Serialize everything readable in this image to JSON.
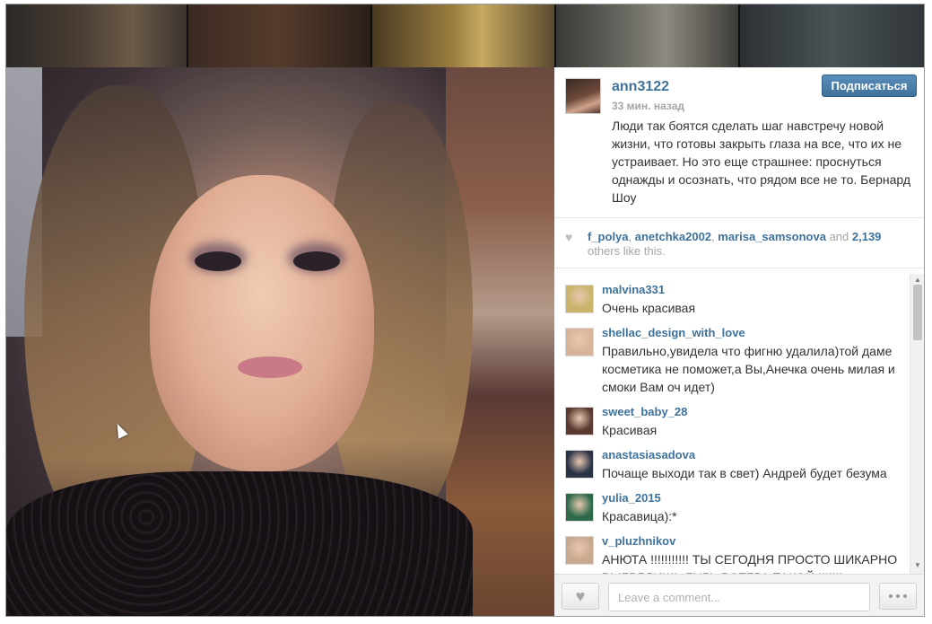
{
  "post": {
    "username": "ann3122",
    "time": "33 мин. назад",
    "follow_label": "Подписаться",
    "caption": "Люди так боятся сделать шаг навстречу новой жизни, что готовы закрыть глаза на все, что их не устраивает. Но это еще страшнее: проснуться однажды и осознать, что рядом все не то. Бернард Шоу"
  },
  "likes": {
    "likers": [
      "f_polya",
      "anetchka2002",
      "marisa_samsonova"
    ],
    "sep1": ", ",
    "sep2": ", ",
    "and_text": " and ",
    "count": "2,139",
    "suffix": " others like this."
  },
  "comments": [
    {
      "user": "malvina331",
      "text": "Очень красивая",
      "avatar_color": "#c9b46a"
    },
    {
      "user": "shellac_design_with_love",
      "text": "Правильно,увидела что фигню удалила)той даме косметика не поможет,а Вы,Анечка очень милая и смоки Вам оч идет)",
      "avatar_color": "#d8b49a"
    },
    {
      "user": "sweet_baby_28",
      "text": "Красивая ",
      "avatar_color": "#5a3a30"
    },
    {
      "user": "anastasiasadova",
      "text": "Почаще выходи так в свет) Андрей будет безума",
      "avatar_color": "#2a3346"
    },
    {
      "user": "yulia_2015",
      "text": "Красавица):*",
      "avatar_color": "#2e6a4a"
    },
    {
      "user": "v_pluzhnikov",
      "text": "АНЮТА !!!!!!!!!!! ТЫ СЕГОДНЯ ПРОСТО ШИКАРНО ВЫГЛЯДИШЬ БУДЬ ВСЕГДА ТАКОЙ !!!!!!!",
      "avatar_color": "#c9a890"
    }
  ],
  "comment_box": {
    "placeholder": "Leave a comment...",
    "like_icon": "heart-icon",
    "more_icon": "more-dots-icon"
  },
  "colors": {
    "link": "#3f729b",
    "follow_button": "#3f729b",
    "muted": "#a5a5a5"
  }
}
